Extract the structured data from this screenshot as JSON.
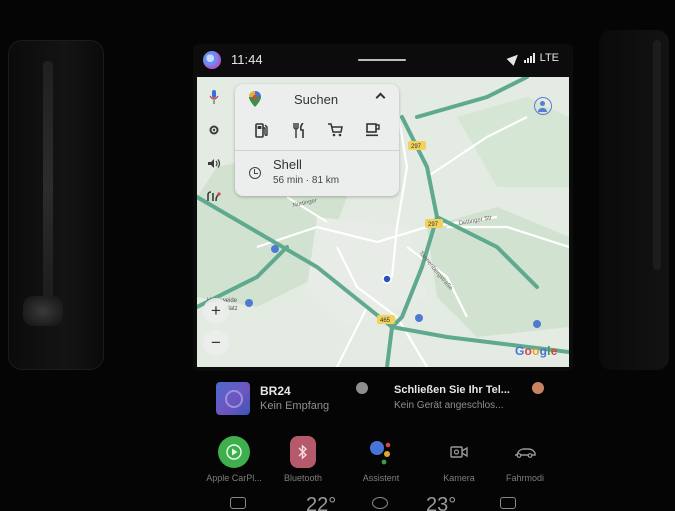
{
  "status_bar": {
    "time": "11:44",
    "network": "LTE"
  },
  "map": {
    "search_label": "Suchen",
    "categories": [
      "gas-station",
      "restaurant",
      "grocery",
      "coffee"
    ],
    "recent_place": "Shell",
    "recent_detail": "56 min · 81 km",
    "attribution": [
      "G",
      "o",
      "o",
      "g",
      "l",
      "e"
    ],
    "zoom_in": "+",
    "zoom_out": "−",
    "labels": {
      "route_b297_a": "297",
      "route_b297_b": "297",
      "route_b465": "465",
      "street_nurtinger": "Nürtinger",
      "street_dettinger": "Dettinger Str",
      "street_tannenberg": "Tannenbergstraße",
      "place_hahnweide": "Hahnweide",
      "place_platz": "platz"
    },
    "colors": {
      "road_major": "#5fa98f",
      "road_minor": "#ffffff",
      "highway_shield": "#f2d15c",
      "forest": "#cfe1cd",
      "land": "#e3ebe3"
    }
  },
  "media": {
    "title": "BR24",
    "subtitle": "Kein Empfang"
  },
  "phone": {
    "title": "Schließen Sie Ihr Tel...",
    "subtitle": "Kein Gerät angeschlos..."
  },
  "dock": [
    {
      "label": "Apple CarPl...",
      "icon": "carplay-icon",
      "color": "#3fae4c"
    },
    {
      "label": "Bluetooth",
      "icon": "bluetooth-icon",
      "color": "#b55a6a"
    },
    {
      "label": "Assistent",
      "icon": "assistant-icon",
      "color": "#4774d8"
    },
    {
      "label": "Kamera",
      "icon": "camera-icon",
      "color": "#9a9a9a"
    },
    {
      "label": "Fahrmodi",
      "icon": "drive-mode-icon",
      "color": "#9a9a9a"
    }
  ],
  "climate": {
    "left_temp": "22°",
    "right_temp": "23°"
  }
}
